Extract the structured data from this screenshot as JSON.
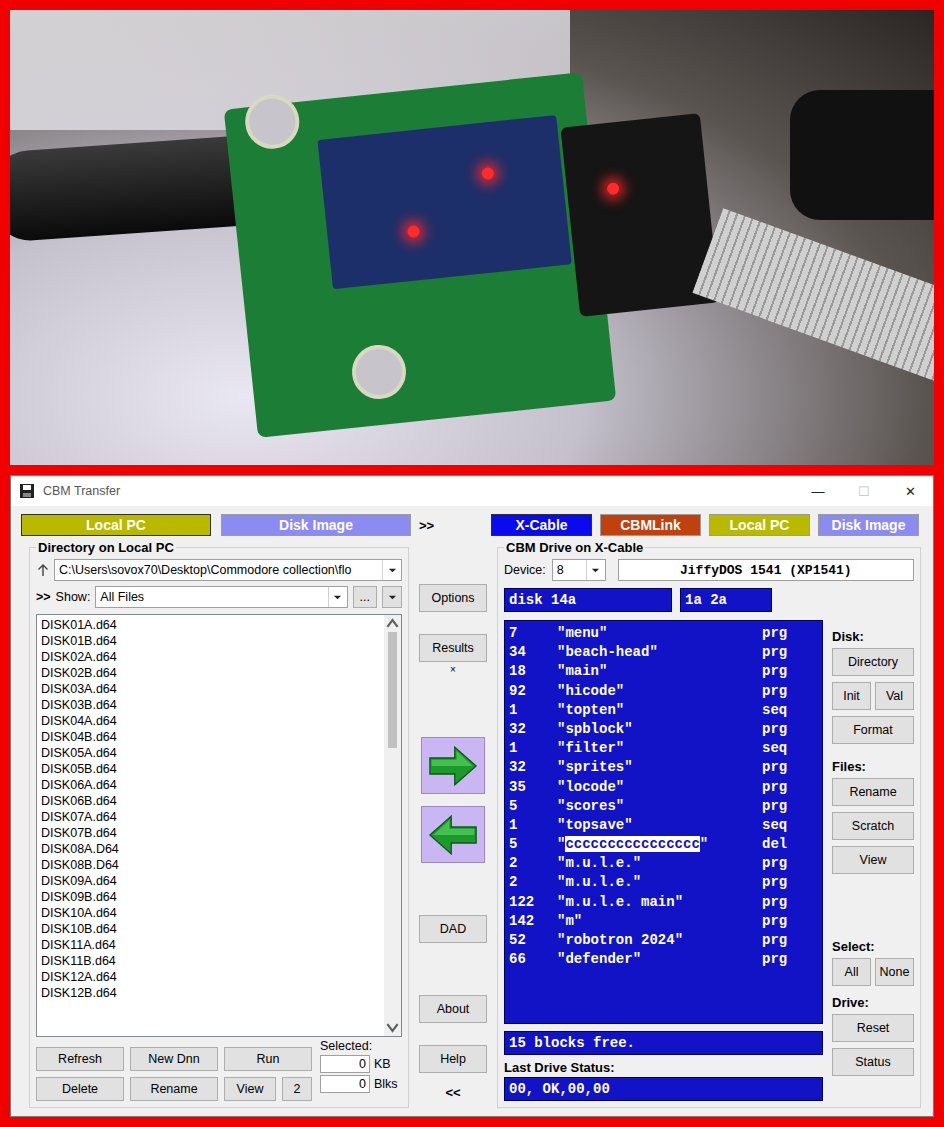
{
  "window": {
    "title": "CBM Transfer",
    "controls": [
      {
        "glyph": "—",
        "disabled": false
      },
      {
        "glyph": "☐",
        "disabled": true
      },
      {
        "glyph": "✕",
        "disabled": false
      }
    ]
  },
  "left_tabs": [
    {
      "label": "Local PC",
      "selected": true,
      "color": "#b9b900"
    },
    {
      "label": "Disk Image",
      "selected": false,
      "color": "#8b8bf2"
    }
  ],
  "tab_separator": ">>",
  "right_tabs": [
    {
      "label": "X-Cable",
      "selected": true,
      "color": "#0a0aee"
    },
    {
      "label": "CBMLink",
      "selected": false,
      "color": "#c0400e"
    },
    {
      "label": "Local PC",
      "selected": false,
      "color": "#b9b900"
    },
    {
      "label": "Disk Image",
      "selected": false,
      "color": "#8b8bf2"
    }
  ],
  "local": {
    "title": "Directory on Local PC",
    "path": "C:\\Users\\sovox70\\Desktop\\Commodore collection\\flo",
    "show_prefix": ">>",
    "show_label": "Show:",
    "filter": "All Files",
    "browse": "...",
    "files": [
      {
        "name": "DISK01A.d64",
        "selected": false
      },
      {
        "name": "DISK01B.d64",
        "selected": false
      },
      {
        "name": "DISK02A.d64",
        "selected": false
      },
      {
        "name": "DISK02B.d64",
        "selected": false
      },
      {
        "name": "DISK03A.d64",
        "selected": false
      },
      {
        "name": "DISK03B.d64",
        "selected": false
      },
      {
        "name": "DISK04A.d64",
        "selected": false
      },
      {
        "name": "DISK04B.d64",
        "selected": false
      },
      {
        "name": "DISK05A.d64",
        "selected": false
      },
      {
        "name": "DISK05B.d64",
        "selected": false
      },
      {
        "name": "DISK06A.d64",
        "selected": false
      },
      {
        "name": "DISK06B.d64",
        "selected": false
      },
      {
        "name": "DISK07A.d64",
        "selected": false
      },
      {
        "name": "DISK07B.d64",
        "selected": false
      },
      {
        "name": "DISK08A.D64",
        "selected": false
      },
      {
        "name": "DISK08B.D64",
        "selected": false
      },
      {
        "name": "DISK09A.d64",
        "selected": false
      },
      {
        "name": "DISK09B.d64",
        "selected": false
      },
      {
        "name": "DISK10A.d64",
        "selected": false
      },
      {
        "name": "DISK10B.d64",
        "selected": false
      },
      {
        "name": "DISK11A.d64",
        "selected": false
      },
      {
        "name": "DISK11B.d64",
        "selected": false
      },
      {
        "name": "DISK12A.d64",
        "selected": false
      },
      {
        "name": "DISK12B.d64",
        "selected": false
      }
    ],
    "scrollbar": {
      "level": 0.3
    },
    "buttons": [
      "Refresh",
      "New Dnn",
      "Run",
      "Delete",
      "Rename",
      "View",
      "2"
    ],
    "selected_label": "Selected:",
    "selected_kb": "0",
    "kb_unit": "KB",
    "selected_blks": "0",
    "blks_unit": "Blks"
  },
  "middle": {
    "options": "Options",
    "results": "Results",
    "results_mark": "×",
    "dad": "DAD",
    "about": "About",
    "help": "Help",
    "collapse": "<<"
  },
  "drive": {
    "title": "CBM Drive on X-Cable",
    "device_label": "Device:",
    "device": "8",
    "drive_type": "JiffyDOS 1541 (XP1541)",
    "disk_name": "disk 14a",
    "disk_id": "1a 2a",
    "quote": "\"",
    "entries": [
      {
        "blocks": "7",
        "name": "menu",
        "type": "prg",
        "reverse": false
      },
      {
        "blocks": "34",
        "name": "beach-head",
        "type": "prg",
        "reverse": false
      },
      {
        "blocks": "18",
        "name": "main",
        "type": "prg",
        "reverse": false
      },
      {
        "blocks": "92",
        "name": "hicode",
        "type": "prg",
        "reverse": false
      },
      {
        "blocks": "1",
        "name": "topten",
        "type": "seq",
        "reverse": false
      },
      {
        "blocks": "32",
        "name": "spblock",
        "type": "prg",
        "reverse": false
      },
      {
        "blocks": "1",
        "name": "filter",
        "type": "seq",
        "reverse": false
      },
      {
        "blocks": "32",
        "name": "sprites",
        "type": "prg",
        "reverse": false
      },
      {
        "blocks": "35",
        "name": "locode",
        "type": "prg",
        "reverse": false
      },
      {
        "blocks": "5",
        "name": "scores",
        "type": "prg",
        "reverse": false
      },
      {
        "blocks": "1",
        "name": "topsave",
        "type": "seq",
        "reverse": false
      },
      {
        "blocks": "5",
        "name": "cccccccccccccccc",
        "type": "del",
        "reverse": true
      },
      {
        "blocks": "2",
        "name": "m.u.l.e.",
        "type": "prg",
        "reverse": false
      },
      {
        "blocks": "2",
        "name": "m.u.l.e.",
        "type": "prg",
        "reverse": false
      },
      {
        "blocks": "122",
        "name": "m.u.l.e. main",
        "type": "prg",
        "reverse": false
      },
      {
        "blocks": "142",
        "name": "m",
        "type": "prg",
        "reverse": false
      },
      {
        "blocks": "52",
        "name": "robotron 2024",
        "type": "prg",
        "reverse": false
      },
      {
        "blocks": "66",
        "name": "defender",
        "type": "prg",
        "reverse": false
      }
    ],
    "blocks_free": "15 blocks free.",
    "status_label": "Last Drive Status:",
    "status": "00, OK,00,00"
  },
  "drive_buttons": [
    {
      "label": "Disk:",
      "rows": [
        [
          "Directory"
        ],
        [
          "Init",
          "Val"
        ],
        [
          "Format"
        ]
      ]
    },
    {
      "label": "Files:",
      "rows": [
        [
          "Rename"
        ],
        [
          "Scratch"
        ],
        [
          "View"
        ]
      ]
    },
    {
      "label": "Select:",
      "rows": [
        [
          "All",
          "None"
        ]
      ]
    },
    {
      "label": "Drive:",
      "rows": [
        [
          "Reset"
        ],
        [
          "Status"
        ]
      ]
    }
  ]
}
